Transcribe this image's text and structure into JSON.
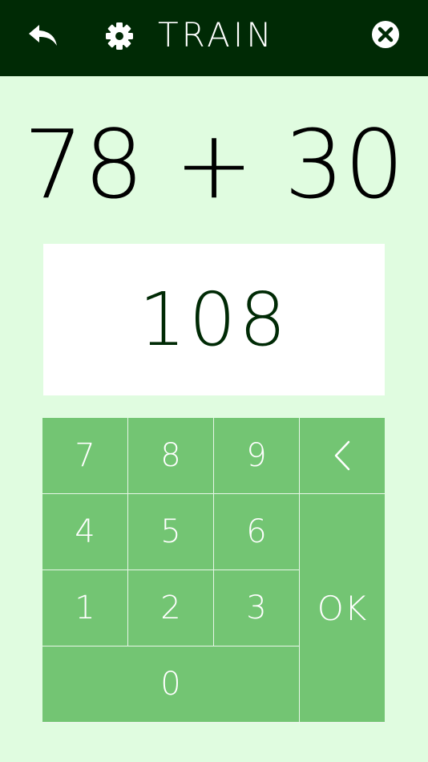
{
  "header": {
    "title": "TRAIN",
    "back_icon": "back-arrow-icon",
    "settings_icon": "gear-icon",
    "close_icon": "close-circle-icon",
    "background": "#002a05"
  },
  "problem": {
    "left": "78",
    "operator": "+",
    "right": "30"
  },
  "answer": {
    "value": "108"
  },
  "keypad": {
    "k7": "7",
    "k8": "8",
    "k9": "9",
    "backspace": "<",
    "k4": "4",
    "k5": "5",
    "k6": "6",
    "ok": "OK",
    "k1": "1",
    "k2": "2",
    "k3": "3",
    "k0": "0",
    "key_color": "#73c573"
  },
  "colors": {
    "page_background": "#e0fce0",
    "answer_text": "#002a05"
  }
}
